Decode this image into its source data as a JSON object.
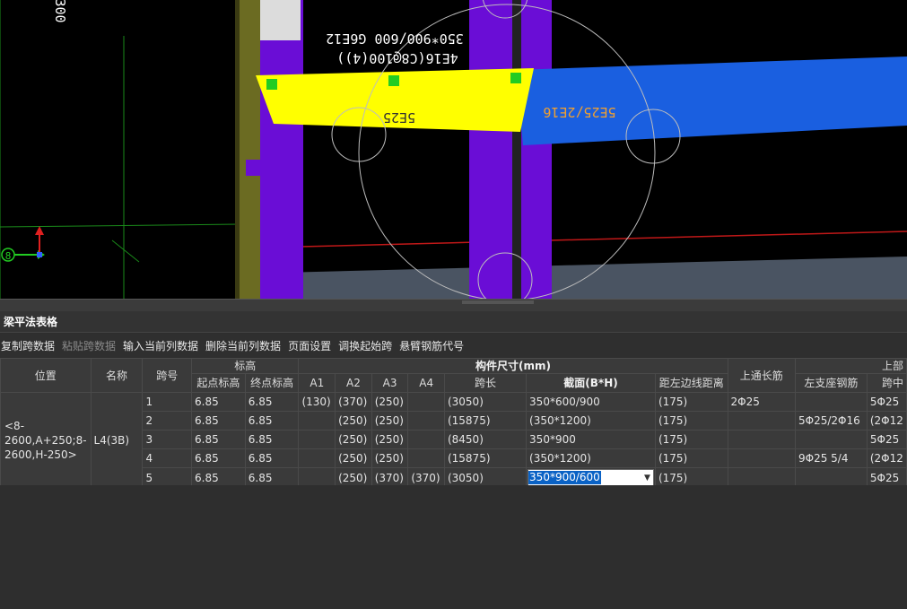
{
  "viewport": {
    "annotations": {
      "beam_spec": "350*900/600 G6E12",
      "stirrup": "4E16(C8@100(4))",
      "beam_left_rebar": "5E25",
      "beam_right_rebar": "5E25/2E16",
      "side_number": "300",
      "axis_label": "8"
    }
  },
  "panel": {
    "title": "梁平法表格"
  },
  "toolbar": {
    "copy_span": "复制跨数据",
    "paste_span": "粘贴跨数据",
    "input_column": "输入当前列数据",
    "delete_column": "删除当前列数据",
    "page_setup": "页面设置",
    "swap_start": "调换起始跨",
    "cantilever_code": "悬臂钢筋代号"
  },
  "table": {
    "headers": {
      "position": "位置",
      "name": "名称",
      "span_no": "跨号",
      "elevation": "标高",
      "start_elev": "起点标高",
      "end_elev": "终点标高",
      "member_size": "构件尺寸(mm)",
      "a1": "A1",
      "a2": "A2",
      "a3": "A3",
      "a4": "A4",
      "span_length": "跨长",
      "section": "截面(B*H)",
      "offset": "距左边线距离",
      "top_continuous": "上通长筋",
      "top_group": "上部",
      "left_support": "左支座钢筋",
      "span_mid": "跨中"
    },
    "position_value": "<8-2600,A+250;8-2600,H-250>",
    "name_value": "L4(3B)",
    "rows": [
      {
        "span": "1",
        "start": "6.85",
        "end": "6.85",
        "a1": "(130)",
        "a2": "(370)",
        "a3": "(250)",
        "a4": "",
        "length": "(3050)",
        "section": "350*600/900",
        "offset": "(175)",
        "top_cont": "2Φ25",
        "left_support": "",
        "mid": "5Φ25"
      },
      {
        "span": "2",
        "start": "6.85",
        "end": "6.85",
        "a1": "",
        "a2": "(250)",
        "a3": "(250)",
        "a4": "",
        "length": "(15875)",
        "section": "(350*1200)",
        "offset": "(175)",
        "top_cont": "",
        "left_support": "5Φ25/2Φ16",
        "mid": "(2Φ12"
      },
      {
        "span": "3",
        "start": "6.85",
        "end": "6.85",
        "a1": "",
        "a2": "(250)",
        "a3": "(250)",
        "a4": "",
        "length": "(8450)",
        "section": "350*900",
        "offset": "(175)",
        "top_cont": "",
        "left_support": "",
        "mid": "5Φ25"
      },
      {
        "span": "4",
        "start": "6.85",
        "end": "6.85",
        "a1": "",
        "a2": "(250)",
        "a3": "(250)",
        "a4": "",
        "length": "(15875)",
        "section": "(350*1200)",
        "offset": "(175)",
        "top_cont": "",
        "left_support": "9Φ25 5/4",
        "mid": "(2Φ12"
      },
      {
        "span": "5",
        "start": "6.85",
        "end": "6.85",
        "a1": "",
        "a2": "(250)",
        "a3": "(370)",
        "a4": "(370)",
        "length": "(3050)",
        "section": "350*900/600",
        "offset": "(175)",
        "top_cont": "",
        "left_support": "",
        "mid": "5Φ25"
      }
    ]
  },
  "colors": {
    "beam_yellow": "#ffff00",
    "beam_blue": "#1a5fe0",
    "column_purple": "#6a0dd6",
    "grid_green": "#1a8a1a",
    "selection_blue": "#0a62c5"
  }
}
